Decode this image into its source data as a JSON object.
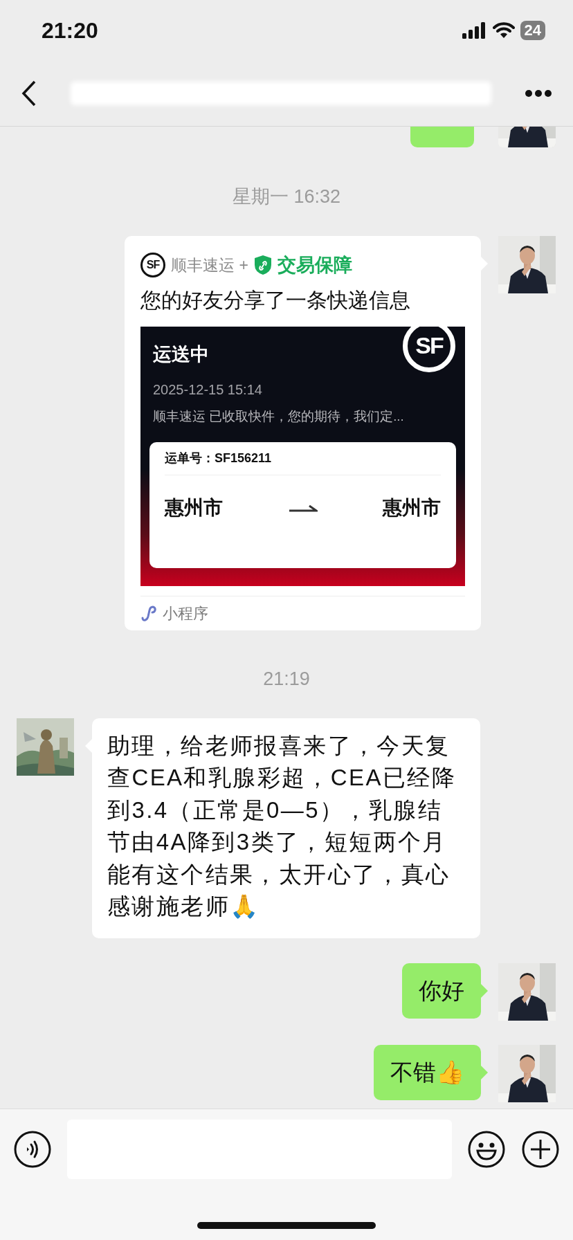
{
  "status_bar": {
    "time": "21:20",
    "battery": "24"
  },
  "messages": [
    {
      "kind": "partial",
      "outgoing": true
    },
    {
      "kind": "time",
      "text": "星期一 16:32"
    },
    {
      "kind": "card",
      "outgoing": true,
      "app_logo": "SF",
      "app": "顺丰速运 +",
      "badge": "交易保障",
      "headline": "您的好友分享了一条快递信息",
      "status": "运送中",
      "panel_logo": "SF",
      "datetime": "2025-12-15 15:14",
      "summary": "顺丰速运 已收取快件，您的期待，我们定...",
      "waybill": "运单号：SF156211",
      "from": "惠州市",
      "to": "惠州市",
      "footer": "小程序"
    },
    {
      "kind": "time",
      "text": "21:19"
    },
    {
      "kind": "text",
      "outgoing": false,
      "text": "助理，给老师报喜来了，今天复查CEA和乳腺彩超，CEA已经降到3.4（正常是0—5），乳腺结节由4A降到3类了，短短两个月能有这个结果，太开心了，真心感谢施老师🙏"
    },
    {
      "kind": "text",
      "outgoing": true,
      "text": "你好"
    },
    {
      "kind": "text",
      "outgoing": true,
      "text": "不错👍"
    }
  ]
}
